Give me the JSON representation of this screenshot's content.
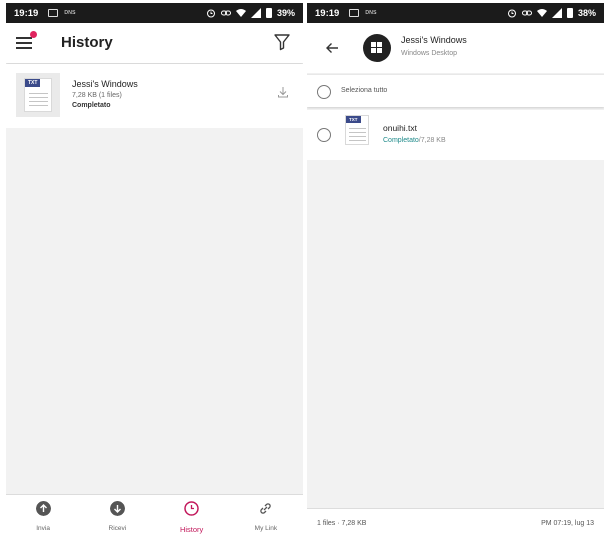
{
  "left": {
    "status": {
      "time": "19:19",
      "battery": "39%",
      "notif_label": "DNS"
    },
    "header": {
      "title": "History"
    },
    "history": [
      {
        "name": "Jessi's Windows",
        "size": "7,28 KB (1 files)",
        "status": "Completato",
        "file_tag": "TXT"
      }
    ],
    "nav": [
      {
        "label": "Invia",
        "icon": "send-icon"
      },
      {
        "label": "Ricevi",
        "icon": "receive-icon"
      },
      {
        "label": "History",
        "icon": "history-icon",
        "active": true
      },
      {
        "label": "My Link",
        "icon": "link-icon"
      }
    ],
    "accent": "#c2185b"
  },
  "right": {
    "status": {
      "time": "19:19",
      "battery": "38%",
      "notif_label": "DNS"
    },
    "device": {
      "name": "Jessi's Windows",
      "type": "Windows Desktop"
    },
    "select_all_label": "Seleziona tutto",
    "file": {
      "name": "onuihi.txt",
      "status": "Completato",
      "size": "/7,28 KB",
      "file_tag": "TXT"
    },
    "footer": {
      "summary": "1 files · 7,28 KB",
      "datetime": "PM 07:19, lug 13"
    },
    "status_color": "#1e8a8a"
  }
}
